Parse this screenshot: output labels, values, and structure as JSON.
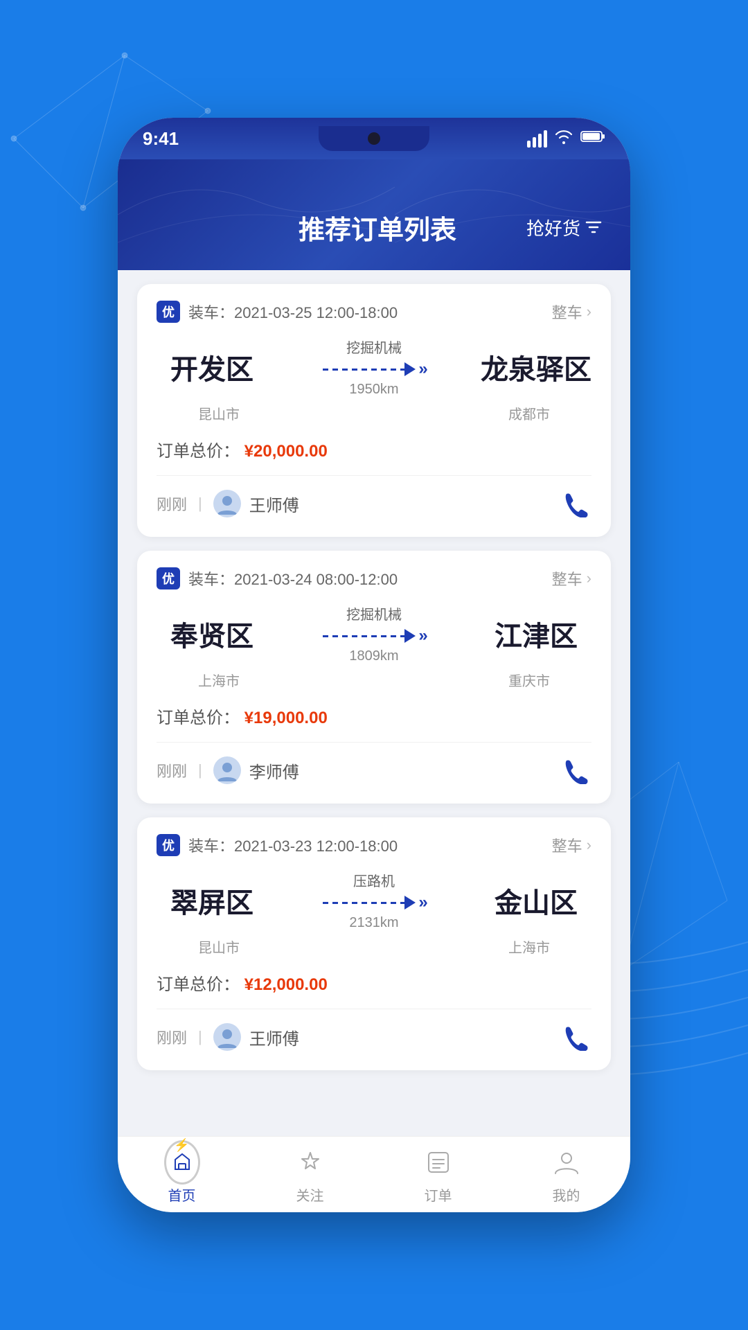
{
  "background": {
    "color": "#1a7de8"
  },
  "status_bar": {
    "time": "9:41",
    "signal": "signal",
    "wifi": "wifi",
    "battery": "battery"
  },
  "header": {
    "title": "推荐订单列表",
    "action_label": "抢好货",
    "filter_icon": "filter"
  },
  "orders": [
    {
      "id": "order-1",
      "badge": "优",
      "date": "装车：2021-03-25 12:00-18:00",
      "type": "整车",
      "from_city": "开发区",
      "from_region": "昆山市",
      "cargo": "挖掘机械",
      "distance": "1950km",
      "to_city": "龙泉驿区",
      "to_region": "成都市",
      "price_label": "订单总价：",
      "price": "¥20,000.00",
      "time_ago": "刚刚",
      "driver_name": "王师傅"
    },
    {
      "id": "order-2",
      "badge": "优",
      "date": "装车：2021-03-24 08:00-12:00",
      "type": "整车",
      "from_city": "奉贤区",
      "from_region": "上海市",
      "cargo": "挖掘机械",
      "distance": "1809km",
      "to_city": "江津区",
      "to_region": "重庆市",
      "price_label": "订单总价：",
      "price": "¥19,000.00",
      "time_ago": "刚刚",
      "driver_name": "李师傅"
    },
    {
      "id": "order-3",
      "badge": "优",
      "date": "装车：2021-03-23 12:00-18:00",
      "type": "整车",
      "from_city": "翠屏区",
      "from_region": "昆山市",
      "cargo": "压路机",
      "distance": "2131km",
      "to_city": "金山区",
      "to_region": "上海市",
      "price_label": "订单总价：",
      "price": "¥12,000.00",
      "time_ago": "刚刚",
      "driver_name": "王师傅"
    }
  ],
  "nav": {
    "items": [
      {
        "id": "home",
        "label": "首页",
        "active": true
      },
      {
        "id": "follow",
        "label": "关注",
        "active": false
      },
      {
        "id": "orders",
        "label": "订单",
        "active": false
      },
      {
        "id": "mine",
        "label": "我的",
        "active": false
      }
    ]
  }
}
